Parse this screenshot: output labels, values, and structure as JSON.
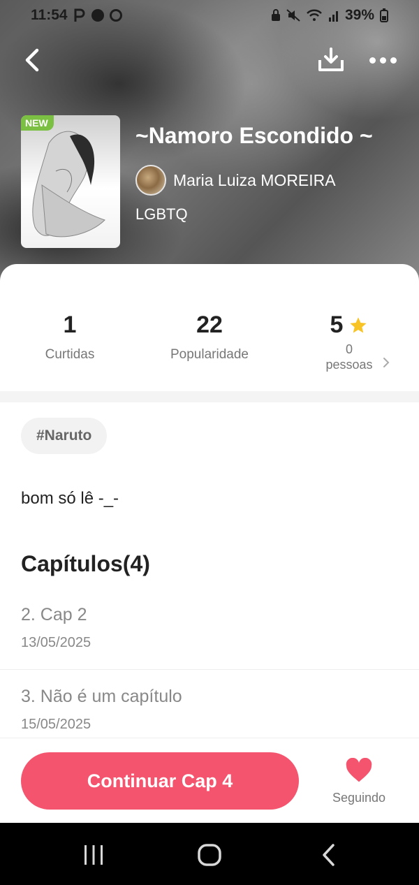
{
  "status_bar": {
    "time": "11:54",
    "battery": "39%",
    "left_icons": [
      "p-icon",
      "messenger-icon",
      "record-icon"
    ],
    "right_icons": [
      "lock-icon",
      "mute-icon",
      "wifi-icon",
      "signal-icon",
      "battery-icon"
    ]
  },
  "work": {
    "badge": "NEW",
    "title": "~Namoro Escondido ~",
    "author": "Maria Luiza MOREIRA",
    "genre": "LGBTQ"
  },
  "stats": {
    "likes_value": "1",
    "likes_label": "Curtidas",
    "popularity_value": "22",
    "popularity_label": "Popularidade",
    "rating_value": "5",
    "rating_count": "0",
    "rating_people_label": "pessoas"
  },
  "tag": "#Naruto",
  "description": "bom só lê -_-",
  "chapters": {
    "heading": "Capítulos(4)",
    "items": [
      {
        "title": "2. Cap 2",
        "date": "13/05/2025"
      },
      {
        "title": "3. Não é um capítulo",
        "date": "15/05/2025"
      }
    ]
  },
  "actions": {
    "continue_label": "Continuar Cap 4",
    "follow_label": "Seguindo"
  },
  "colors": {
    "accent": "#f5546e",
    "new_badge": "#7bc043",
    "star": "#f7c325"
  }
}
